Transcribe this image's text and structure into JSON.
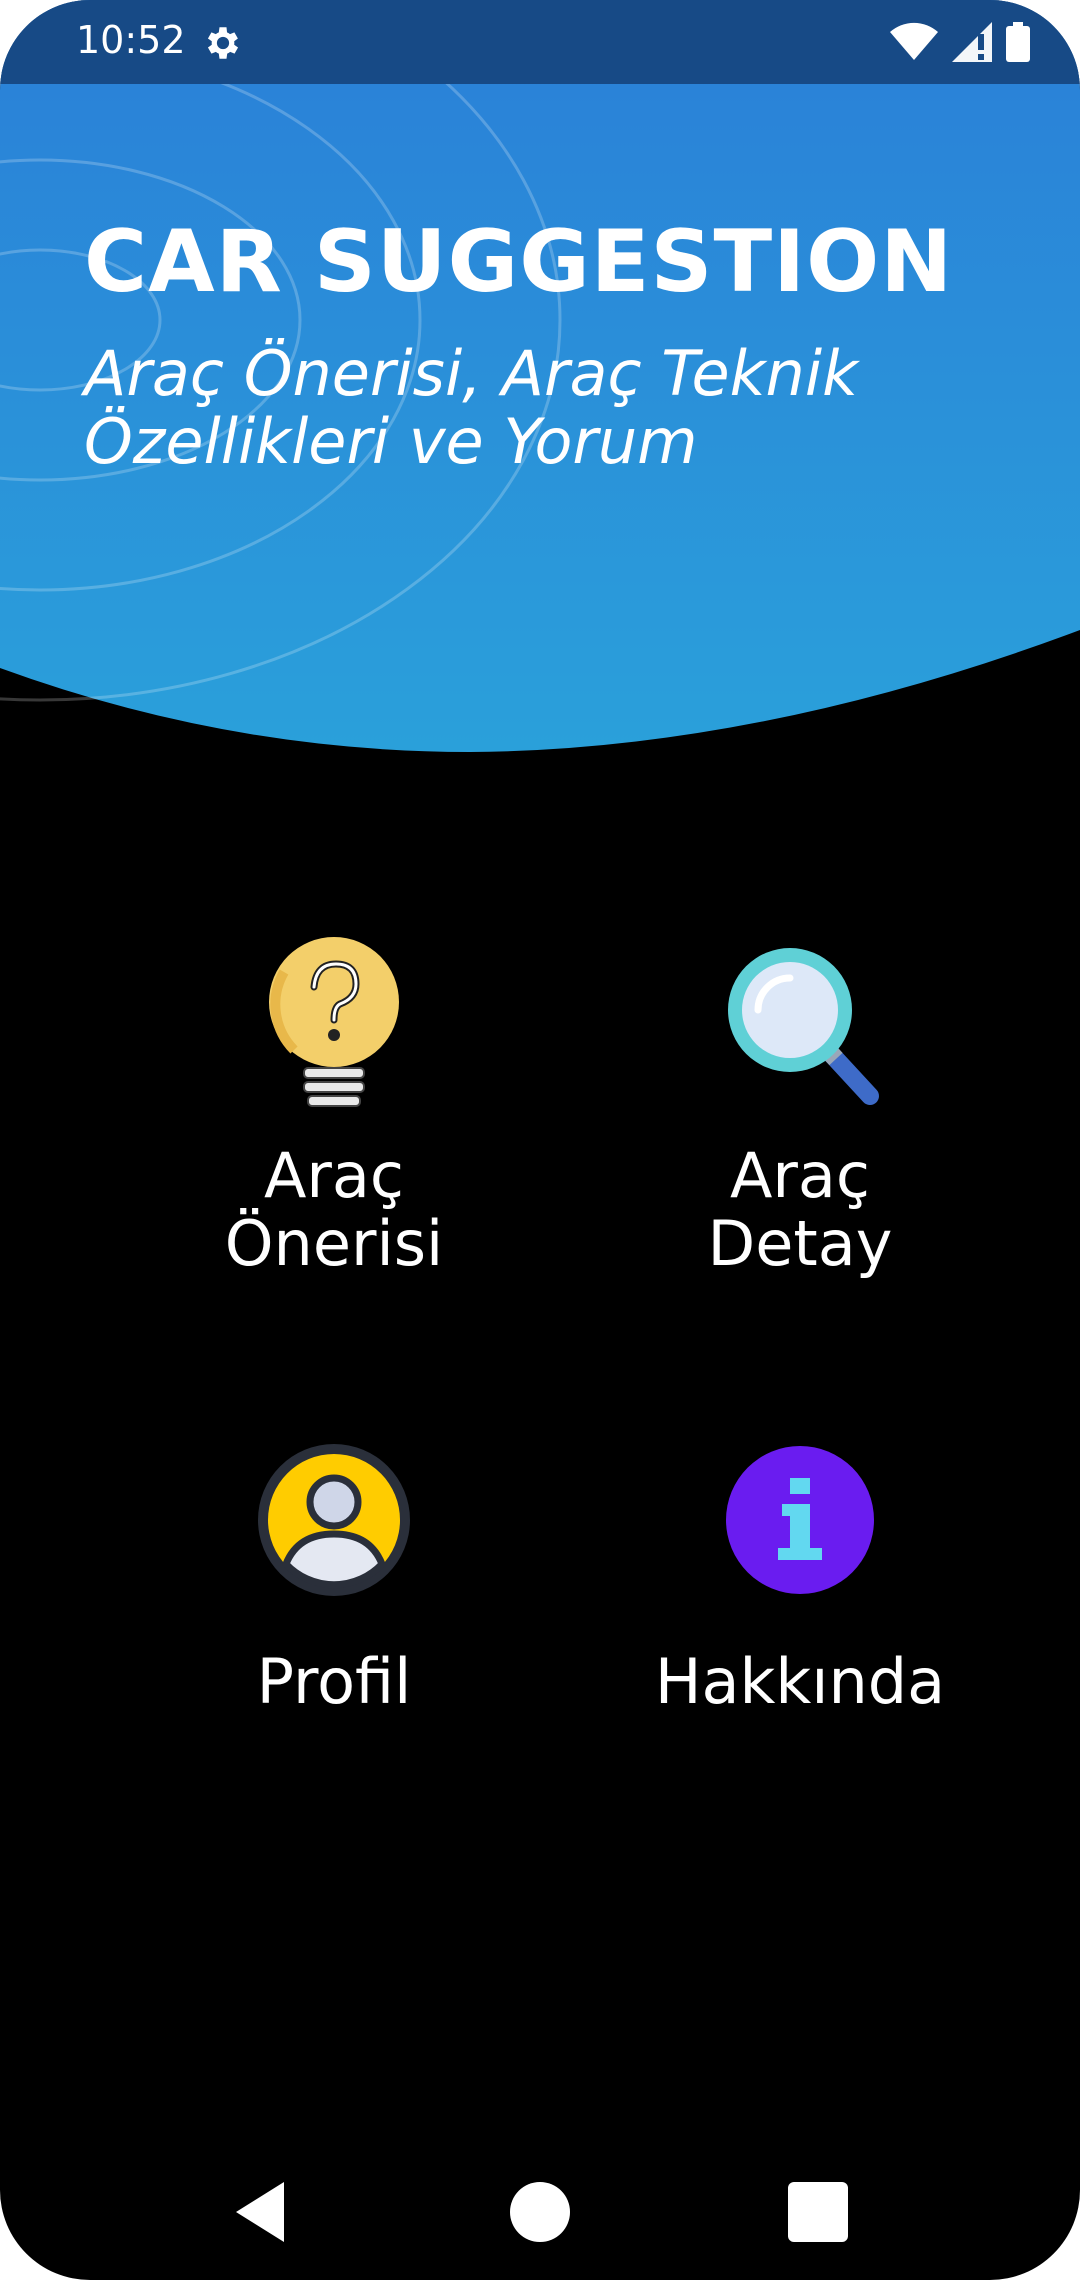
{
  "status_bar": {
    "time": "10:52",
    "icons": [
      "settings-icon",
      "wifi-icon",
      "signal-icon",
      "battery-icon"
    ]
  },
  "header": {
    "title": "CAR SUGGESTION",
    "subtitle": "Araç Önerisi, Araç Teknik Özellikleri ve Yorum"
  },
  "menu": [
    {
      "icon": "lightbulb-question-icon",
      "label_lines": [
        "Araç",
        "Önerisi"
      ]
    },
    {
      "icon": "magnifier-icon",
      "label_lines": [
        "Araç",
        "Detay"
      ]
    },
    {
      "icon": "user-profile-icon",
      "label_lines": [
        "Profil"
      ]
    },
    {
      "icon": "info-icon",
      "label_lines": [
        "Hakkında"
      ]
    }
  ],
  "nav_bar": {
    "buttons": [
      "back-icon",
      "home-icon",
      "recents-icon"
    ]
  },
  "colors": {
    "status_bar": "#174a86",
    "header_top": "#2a7fd8",
    "header_bottom": "#2aa0da",
    "background": "#000000",
    "text": "#ffffff"
  }
}
